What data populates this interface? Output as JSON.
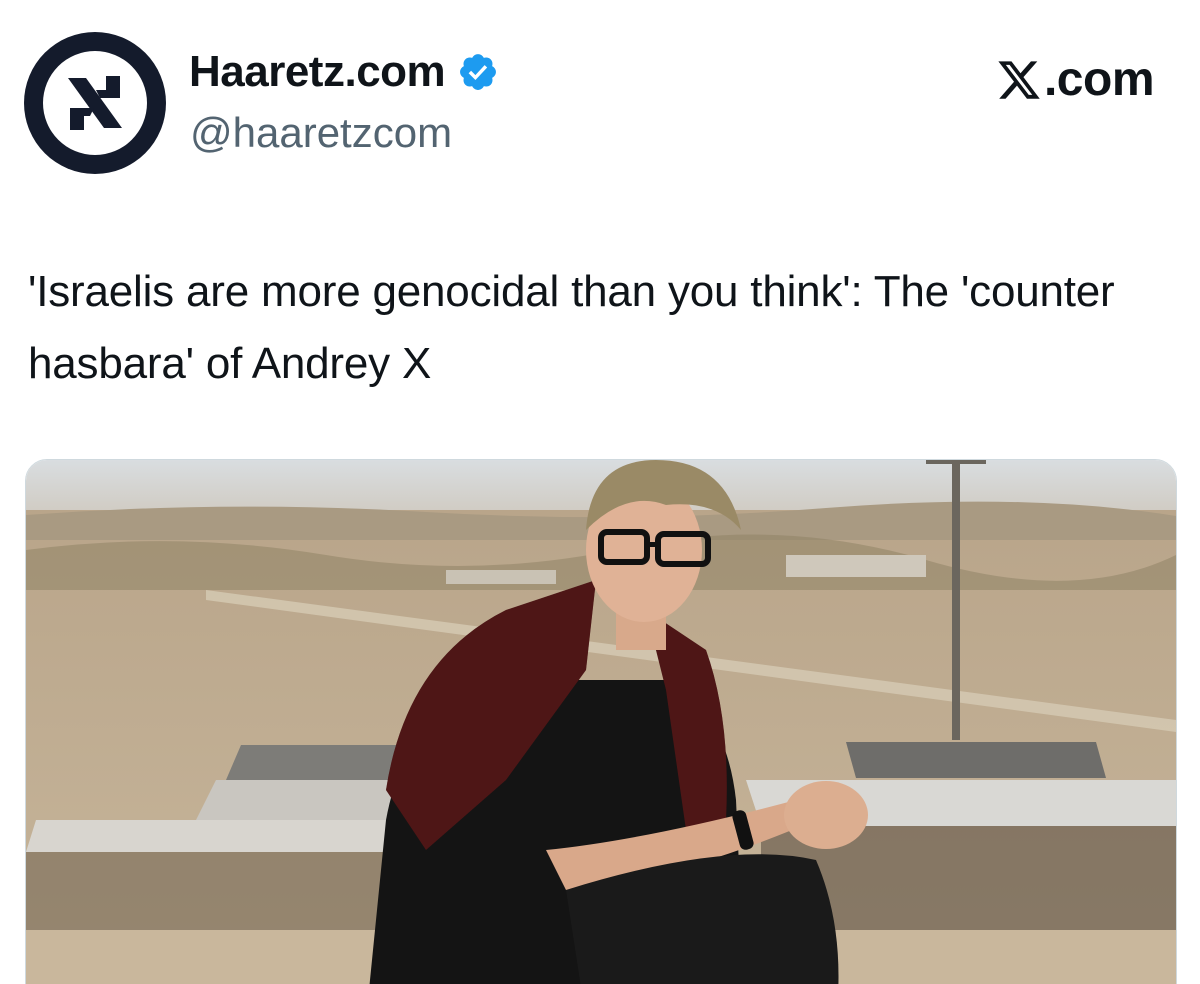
{
  "account": {
    "display_name": "Haaretz.com",
    "handle": "@haaretzcom",
    "verified": true,
    "avatar_icon": "haaretz-logo-icon",
    "verified_icon": "verified-badge-icon",
    "verified_color": "#1d9bf0"
  },
  "brand": {
    "label": ".com",
    "icon": "x-logo-icon"
  },
  "tweet": {
    "text": "'Israelis are more genocidal than you think': The 'counter hasbara' of Andrey X"
  },
  "media": {
    "icon": "photo-image"
  },
  "colors": {
    "avatar_bg": "#141b2c",
    "handle": "#536471",
    "text": "#0f1419"
  }
}
